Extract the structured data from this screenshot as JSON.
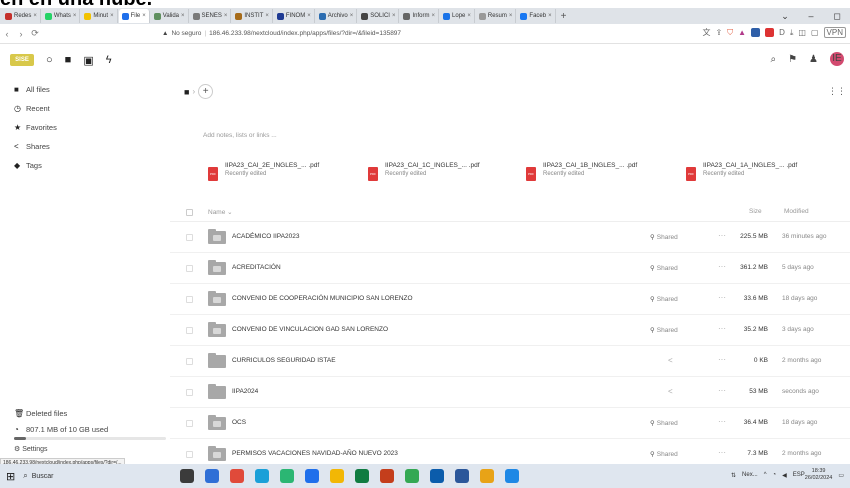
{
  "caption": "en en una nube.",
  "browser": {
    "tabs": [
      {
        "label": "Redes",
        "color": "#c4302b"
      },
      {
        "label": "Whats",
        "color": "#25d366"
      },
      {
        "label": "Minut",
        "color": "#f2c200"
      },
      {
        "label": "File",
        "color": "#1f6feb",
        "active": true
      },
      {
        "label": "Valida",
        "color": "#5f8f5f"
      },
      {
        "label": "SENES",
        "color": "#7a7a7a"
      },
      {
        "label": "INSTIT",
        "color": "#a66b1a"
      },
      {
        "label": "FINOM",
        "color": "#1f3a93"
      },
      {
        "label": "Archivo",
        "color": "#2b6cb0"
      },
      {
        "label": "SOLICI",
        "color": "#444"
      },
      {
        "label": "Inform",
        "color": "#666"
      },
      {
        "label": "Lope",
        "color": "#1a73e8"
      },
      {
        "label": "Resum",
        "color": "#999"
      },
      {
        "label": "Faceb",
        "color": "#1877f2"
      }
    ],
    "new_tab": "+",
    "window_controls": [
      "⌄",
      "–",
      "◻"
    ],
    "url_prefix": "No seguro",
    "url": "186.46.233.98/nextcloud/index.php/apps/files/?dir=/&fileid=135897",
    "vpn": "VPN"
  },
  "header": {
    "logo": "SISE"
  },
  "sidebar": {
    "items": [
      {
        "label": "All files",
        "icon": "folder-icon"
      },
      {
        "label": "Recent",
        "icon": "clock-icon"
      },
      {
        "label": "Favorites",
        "icon": "star-icon"
      },
      {
        "label": "Shares",
        "icon": "share-icon"
      },
      {
        "label": "Tags",
        "icon": "tag-icon"
      }
    ],
    "deleted": "Deleted files",
    "quota": "807.1 MB of 10 GB used",
    "quota_fraction": 0.08,
    "settings": "Settings",
    "status_url": "186.46.233.98/nextcloud/index.php/apps/files/?dir=/..."
  },
  "main": {
    "notes_placeholder": "Add notes, lists or links ...",
    "recent": [
      {
        "name": "IIPA23_CAI_2E_INGLES_... .pdf",
        "sub": "Recently edited"
      },
      {
        "name": "IIPA23_CAI_1C_INGLES_... .pdf",
        "sub": "Recently edited"
      },
      {
        "name": "IIPA23_CAI_1B_INGLES_... .pdf",
        "sub": "Recently edited"
      },
      {
        "name": "IIPA23_CAI_1A_INGLES_... .pdf",
        "sub": "Recently edited"
      }
    ],
    "columns": {
      "name": "Name",
      "size": "Size",
      "modified": "Modified"
    },
    "rows": [
      {
        "name": "ACADÉMICO IIPA2023",
        "shared": "Shared",
        "size": "225.5 MB",
        "modified": "36 minutes ago",
        "badge": true
      },
      {
        "name": "ACREDITACIÓN",
        "shared": "Shared",
        "size": "361.2 MB",
        "modified": "5 days ago",
        "badge": true
      },
      {
        "name": "CONVENIO DE COOPERACIÓN MUNICIPIO SAN LORENZO",
        "shared": "Shared",
        "size": "33.6 MB",
        "modified": "18 days ago",
        "badge": true
      },
      {
        "name": "CONVENIO DE VINCULACION GAD SAN LORENZO",
        "shared": "Shared",
        "size": "35.2 MB",
        "modified": "3 days ago",
        "badge": true
      },
      {
        "name": "CURRICULOS SEGURIDAD ISTAE",
        "shared": "",
        "size": "0 KB",
        "modified": "2 months ago",
        "badge": false
      },
      {
        "name": "IIPA2024",
        "shared": "",
        "size": "53 MB",
        "modified": "seconds ago",
        "badge": false
      },
      {
        "name": "OCS",
        "shared": "Shared",
        "size": "36.4 MB",
        "modified": "18 days ago",
        "badge": true
      },
      {
        "name": "PERMISOS VACACIONES NAVIDAD-AÑO NUEVO 2023",
        "shared": "Shared",
        "size": "7.3 MB",
        "modified": "2 months ago",
        "badge": true
      }
    ]
  },
  "taskbar": {
    "search": "Buscar",
    "window_label": "Nex...",
    "lang": "ESP",
    "time": "18:39",
    "date": "26/02/2024",
    "icon_colors": [
      "#3b3b3b",
      "#2f6fd6",
      "#e04a3a",
      "#1aa0d8",
      "#2bb673",
      "#1f6feb",
      "#f2b705",
      "#107c41",
      "#c43e1c",
      "#34a853",
      "#0b5cab",
      "#2b579a",
      "#e8a317",
      "#1e88e5"
    ]
  }
}
